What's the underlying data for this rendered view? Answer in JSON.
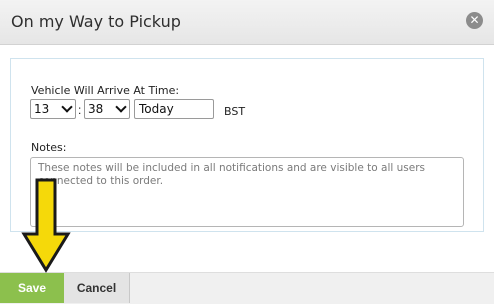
{
  "dialog": {
    "title": "On my Way to Pickup",
    "close_icon": "close-circle-icon"
  },
  "form": {
    "arrive_label": "Vehicle Will Arrive At Time:",
    "hour_value": "13",
    "minute_value": "38",
    "time_separator": ":",
    "date_value": "Today",
    "timezone": "BST",
    "notes_label": "Notes:",
    "notes_placeholder": "These notes will be included in all notifications and are visible to all users connected to this order."
  },
  "footer": {
    "save_label": "Save",
    "cancel_label": "Cancel"
  },
  "colors": {
    "save_button": "#8cc04d",
    "arrow_fill": "#f5d90a",
    "arrow_stroke": "#1a1a1a"
  },
  "annotation": {
    "arrow_icon": "down-arrow-pointer-icon"
  }
}
